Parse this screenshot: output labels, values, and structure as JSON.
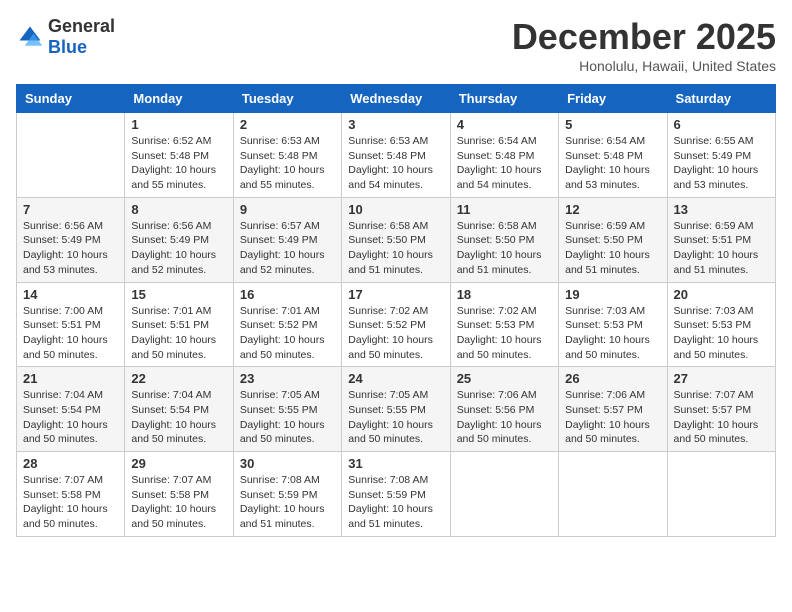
{
  "header": {
    "logo": {
      "general": "General",
      "blue": "Blue"
    },
    "title": "December 2025",
    "subtitle": "Honolulu, Hawaii, United States"
  },
  "days_of_week": [
    "Sunday",
    "Monday",
    "Tuesday",
    "Wednesday",
    "Thursday",
    "Friday",
    "Saturday"
  ],
  "weeks": [
    [
      {
        "day": "",
        "info": ""
      },
      {
        "day": "1",
        "info": "Sunrise: 6:52 AM\nSunset: 5:48 PM\nDaylight: 10 hours\nand 55 minutes."
      },
      {
        "day": "2",
        "info": "Sunrise: 6:53 AM\nSunset: 5:48 PM\nDaylight: 10 hours\nand 55 minutes."
      },
      {
        "day": "3",
        "info": "Sunrise: 6:53 AM\nSunset: 5:48 PM\nDaylight: 10 hours\nand 54 minutes."
      },
      {
        "day": "4",
        "info": "Sunrise: 6:54 AM\nSunset: 5:48 PM\nDaylight: 10 hours\nand 54 minutes."
      },
      {
        "day": "5",
        "info": "Sunrise: 6:54 AM\nSunset: 5:48 PM\nDaylight: 10 hours\nand 53 minutes."
      },
      {
        "day": "6",
        "info": "Sunrise: 6:55 AM\nSunset: 5:49 PM\nDaylight: 10 hours\nand 53 minutes."
      }
    ],
    [
      {
        "day": "7",
        "info": "Sunrise: 6:56 AM\nSunset: 5:49 PM\nDaylight: 10 hours\nand 53 minutes."
      },
      {
        "day": "8",
        "info": "Sunrise: 6:56 AM\nSunset: 5:49 PM\nDaylight: 10 hours\nand 52 minutes."
      },
      {
        "day": "9",
        "info": "Sunrise: 6:57 AM\nSunset: 5:49 PM\nDaylight: 10 hours\nand 52 minutes."
      },
      {
        "day": "10",
        "info": "Sunrise: 6:58 AM\nSunset: 5:50 PM\nDaylight: 10 hours\nand 51 minutes."
      },
      {
        "day": "11",
        "info": "Sunrise: 6:58 AM\nSunset: 5:50 PM\nDaylight: 10 hours\nand 51 minutes."
      },
      {
        "day": "12",
        "info": "Sunrise: 6:59 AM\nSunset: 5:50 PM\nDaylight: 10 hours\nand 51 minutes."
      },
      {
        "day": "13",
        "info": "Sunrise: 6:59 AM\nSunset: 5:51 PM\nDaylight: 10 hours\nand 51 minutes."
      }
    ],
    [
      {
        "day": "14",
        "info": "Sunrise: 7:00 AM\nSunset: 5:51 PM\nDaylight: 10 hours\nand 50 minutes."
      },
      {
        "day": "15",
        "info": "Sunrise: 7:01 AM\nSunset: 5:51 PM\nDaylight: 10 hours\nand 50 minutes."
      },
      {
        "day": "16",
        "info": "Sunrise: 7:01 AM\nSunset: 5:52 PM\nDaylight: 10 hours\nand 50 minutes."
      },
      {
        "day": "17",
        "info": "Sunrise: 7:02 AM\nSunset: 5:52 PM\nDaylight: 10 hours\nand 50 minutes."
      },
      {
        "day": "18",
        "info": "Sunrise: 7:02 AM\nSunset: 5:53 PM\nDaylight: 10 hours\nand 50 minutes."
      },
      {
        "day": "19",
        "info": "Sunrise: 7:03 AM\nSunset: 5:53 PM\nDaylight: 10 hours\nand 50 minutes."
      },
      {
        "day": "20",
        "info": "Sunrise: 7:03 AM\nSunset: 5:53 PM\nDaylight: 10 hours\nand 50 minutes."
      }
    ],
    [
      {
        "day": "21",
        "info": "Sunrise: 7:04 AM\nSunset: 5:54 PM\nDaylight: 10 hours\nand 50 minutes."
      },
      {
        "day": "22",
        "info": "Sunrise: 7:04 AM\nSunset: 5:54 PM\nDaylight: 10 hours\nand 50 minutes."
      },
      {
        "day": "23",
        "info": "Sunrise: 7:05 AM\nSunset: 5:55 PM\nDaylight: 10 hours\nand 50 minutes."
      },
      {
        "day": "24",
        "info": "Sunrise: 7:05 AM\nSunset: 5:55 PM\nDaylight: 10 hours\nand 50 minutes."
      },
      {
        "day": "25",
        "info": "Sunrise: 7:06 AM\nSunset: 5:56 PM\nDaylight: 10 hours\nand 50 minutes."
      },
      {
        "day": "26",
        "info": "Sunrise: 7:06 AM\nSunset: 5:57 PM\nDaylight: 10 hours\nand 50 minutes."
      },
      {
        "day": "27",
        "info": "Sunrise: 7:07 AM\nSunset: 5:57 PM\nDaylight: 10 hours\nand 50 minutes."
      }
    ],
    [
      {
        "day": "28",
        "info": "Sunrise: 7:07 AM\nSunset: 5:58 PM\nDaylight: 10 hours\nand 50 minutes."
      },
      {
        "day": "29",
        "info": "Sunrise: 7:07 AM\nSunset: 5:58 PM\nDaylight: 10 hours\nand 50 minutes."
      },
      {
        "day": "30",
        "info": "Sunrise: 7:08 AM\nSunset: 5:59 PM\nDaylight: 10 hours\nand 51 minutes."
      },
      {
        "day": "31",
        "info": "Sunrise: 7:08 AM\nSunset: 5:59 PM\nDaylight: 10 hours\nand 51 minutes."
      },
      {
        "day": "",
        "info": ""
      },
      {
        "day": "",
        "info": ""
      },
      {
        "day": "",
        "info": ""
      }
    ]
  ]
}
